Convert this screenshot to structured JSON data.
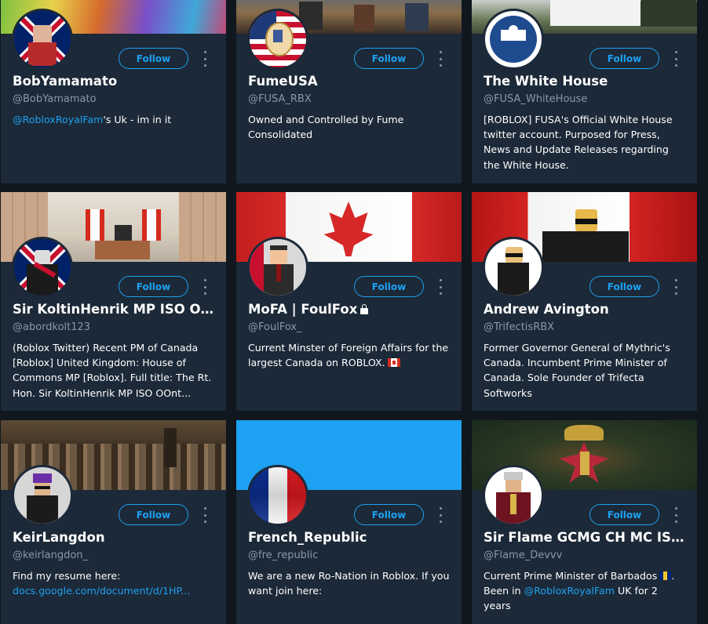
{
  "follow_label": "Follow",
  "cards": [
    {
      "name": "BobYamamato",
      "handle": "@BobYamamato",
      "bio_mention": "@RobloxRoyalFam",
      "bio_text": "'s Uk - im in it"
    },
    {
      "name": "FumeUSA",
      "handle": "@FUSA_RBX",
      "bio_text": "Owned and Controlled by Fume Consolidated"
    },
    {
      "name": "The White House",
      "handle": "@FUSA_WhiteHouse",
      "bio_text": "[ROBLOX] FUSA's Official White House twitter account. Purposed for Press, News and Update Releases regarding the White House."
    },
    {
      "name": "Sir KoltinHenrik MP ISO OOnt...",
      "handle": "@abordkolt123",
      "bio_text": "(Roblox Twitter) Recent PM of Canada [Roblox] United Kingdom: House of Commons MP [Roblox]. Full title: The Rt. Hon. Sir KoltinHenrik MP ISO OOnt..."
    },
    {
      "name": "MoFA | FoulFox",
      "handle": "@FoulFox_",
      "bio_text": "Current Minster of Foreign Affairs for the largest Canada on ROBLOX."
    },
    {
      "name": "Andrew Avington",
      "handle": "@TrifectisRBX",
      "bio_text": "Former Governor General of Mythric's Canada. Incumbent Prime Minister of Canada. Sole Founder of Trifecta Softworks"
    },
    {
      "name": "KeirLangdon",
      "handle": "@keirlangdon_",
      "bio_text": "Find my resume here:",
      "bio_link": "docs.google.com/document/d/1HP..."
    },
    {
      "name": "French_Republic",
      "handle": "@fre_republic",
      "bio_text": "We are a new Ro-Nation in Roblox. If you want join here:"
    },
    {
      "name": "Sir Flame GCMG CH MC ISO ...",
      "handle": "@Flame_Devvv",
      "bio_text_1": "Current Prime Minister of Barbados",
      "bio_text_2": "Been in",
      "bio_mention": "@RobloxRoyalFam",
      "bio_text_3": "UK for 2 years"
    }
  ]
}
